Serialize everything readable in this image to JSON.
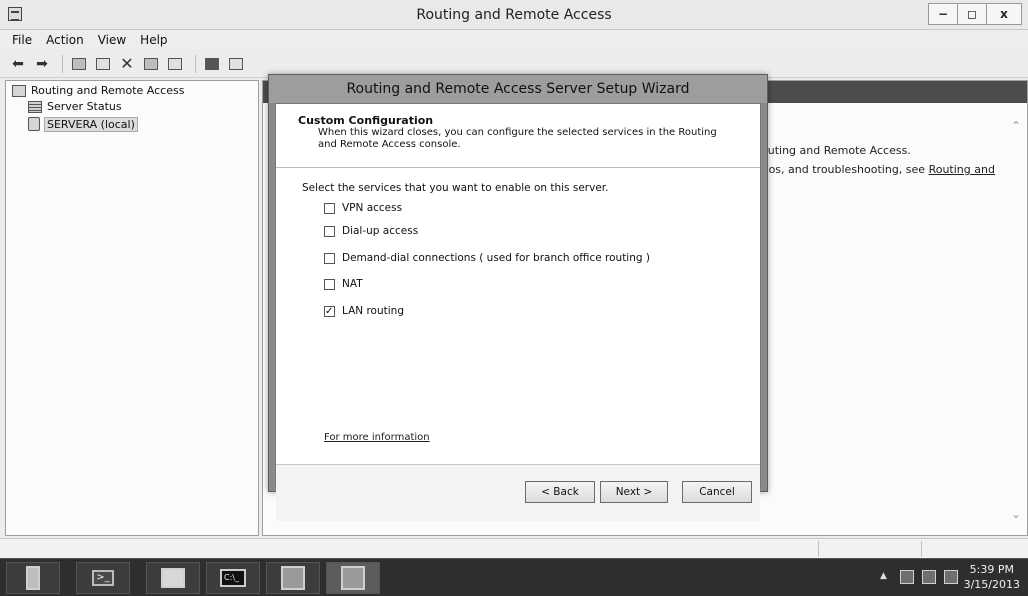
{
  "window": {
    "title": "Routing and Remote Access",
    "buttons": {
      "minimize": "−",
      "restore": "◻",
      "close": "x"
    }
  },
  "menu": [
    "File",
    "Action",
    "View",
    "Help"
  ],
  "tree": {
    "root": "Routing and Remote Access",
    "items": [
      "Server Status",
      "SERVERA (local)"
    ]
  },
  "right_pane": {
    "line1": "outing and Remote Access.",
    "line2_prefix": "rios, and troubleshooting, see ",
    "line2_link": "Routing and"
  },
  "wizard": {
    "title": "Routing and Remote Access Server Setup Wizard",
    "header_title": "Custom Configuration",
    "header_desc": "When this wizard closes, you can configure the selected services in the Routing and Remote Access console.",
    "prompt": "Select the services that you want to enable on this server.",
    "options": [
      {
        "label": "VPN access",
        "checked": false
      },
      {
        "label": "Dial-up access",
        "checked": false
      },
      {
        "label": "Demand-dial connections ( used for branch office routing )",
        "checked": false
      },
      {
        "label": "NAT",
        "checked": false
      },
      {
        "label": "LAN routing",
        "checked": true
      }
    ],
    "more_info": "For more information",
    "buttons": {
      "back": "< Back",
      "next": "Next >",
      "cancel": "Cancel"
    }
  },
  "taskbar": {
    "clock_time": "5:39 PM",
    "clock_date": "3/15/2013",
    "tray_arrow": "▲"
  }
}
